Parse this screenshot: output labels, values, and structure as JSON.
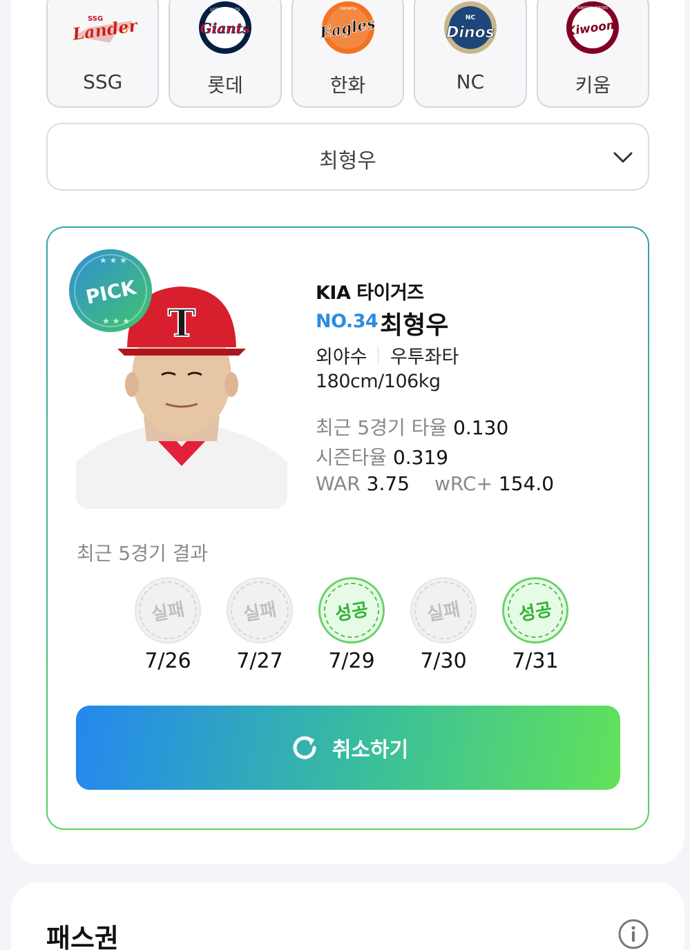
{
  "teams": [
    {
      "name": "SSG",
      "logo_text": "Landers",
      "logo_top": "SSG",
      "color": "#c8102e",
      "selected": false
    },
    {
      "name": "롯데",
      "logo_text": "Giants",
      "logo_top": "LOTTE GIANTS",
      "color": "#041e42",
      "selected": false
    },
    {
      "name": "한화",
      "logo_text": "Eagles",
      "logo_top": "Hanwha",
      "color": "#f37321",
      "selected": false
    },
    {
      "name": "NC",
      "logo_text": "Dinos",
      "logo_top": "NC",
      "color": "#1d467a",
      "selected": false
    },
    {
      "name": "키움",
      "logo_text": "Kiwoom",
      "logo_top": "KIWOOM HEROES",
      "color": "#820024",
      "selected": false
    }
  ],
  "player_select": {
    "value": "최형우",
    "icon": "chevron-down-icon"
  },
  "player": {
    "badge": "PICK",
    "team": "KIA 타이거즈",
    "number": "NO.34",
    "name": "최형우",
    "position": "외야수",
    "hand": "우투좌타",
    "body": "180cm/106kg",
    "cap_letter": "T",
    "stats": {
      "recent_avg_label": "최근 5경기 타율",
      "recent_avg": "0.130",
      "season_avg_label": "시즌타율",
      "season_avg": "0.319",
      "war_label": "WAR",
      "war": "3.75",
      "wrc_label": "wRC+",
      "wrc": "154.0"
    }
  },
  "recent": {
    "title": "최근 5경기 결과",
    "games": [
      {
        "result": "실패",
        "date": "7/26",
        "success": false
      },
      {
        "result": "실패",
        "date": "7/27",
        "success": false
      },
      {
        "result": "성공",
        "date": "7/29",
        "success": true
      },
      {
        "result": "실패",
        "date": "7/30",
        "success": false
      },
      {
        "result": "성공",
        "date": "7/31",
        "success": true
      }
    ]
  },
  "cancel_button": {
    "label": "취소하기",
    "icon": "refresh-icon"
  },
  "pass": {
    "title": "패스권",
    "icon": "info-icon"
  },
  "colors": {
    "accent_blue": "#2b8de0",
    "gradient_start": "#2387f0",
    "gradient_end": "#62e25a",
    "success_green": "#33b133",
    "fail_gray": "#c0c0c0"
  }
}
